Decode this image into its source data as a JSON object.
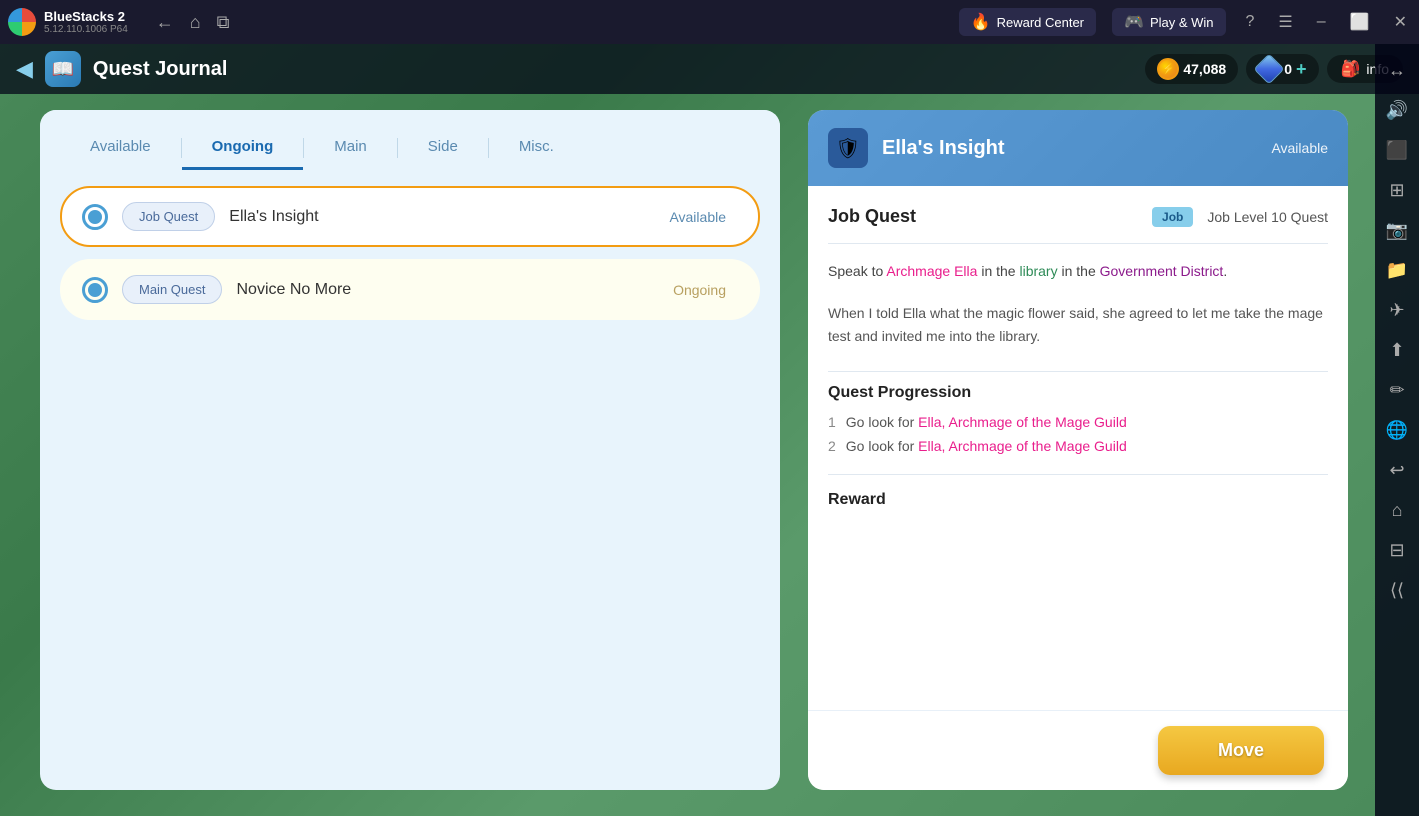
{
  "app": {
    "name": "BlueStacks 2",
    "version": "5.12.110.1006 P64",
    "logo_colors": [
      "#e74c3c",
      "#f39c12",
      "#2ecc71",
      "#3498db"
    ]
  },
  "topbar": {
    "back_label": "←",
    "home_label": "⌂",
    "copy_label": "⧉",
    "reward_center_label": "Reward Center",
    "play_win_label": "Play & Win",
    "help_label": "?",
    "menu_label": "☰",
    "minimize_label": "–",
    "restore_label": "⬜",
    "close_label": "✕",
    "back_arrow_label": "⟨⟨"
  },
  "game_ui": {
    "back_arrow": "◀",
    "quest_journal_title": "Quest Journal",
    "coin_amount": "47,088",
    "gem_amount": "0",
    "add_label": "+",
    "bag_icon": "🎒",
    "info_label": "info"
  },
  "quest_journal": {
    "tabs": [
      {
        "id": "available",
        "label": "Available",
        "active": false
      },
      {
        "id": "ongoing",
        "label": "Ongoing",
        "active": true
      },
      {
        "id": "main",
        "label": "Main",
        "active": false
      },
      {
        "id": "side",
        "label": "Side",
        "active": false
      },
      {
        "id": "misc",
        "label": "Misc.",
        "active": false
      }
    ],
    "quests": [
      {
        "id": "ellas-insight",
        "type": "Job Quest",
        "name": "Ella's Insight",
        "status": "Available",
        "selected": true
      },
      {
        "id": "novice-no-more",
        "type": "Main Quest",
        "name": "Novice No More",
        "status": "Ongoing",
        "selected": false
      }
    ]
  },
  "quest_detail": {
    "title": "Ella's Insight",
    "status": "Available",
    "type_label": "Job Quest",
    "job_badge": "Job",
    "level_label": "Job Level 10 Quest",
    "description_parts": [
      {
        "text": "Speak to ",
        "type": "normal"
      },
      {
        "text": "Archmage Ella",
        "type": "pink"
      },
      {
        "text": " in the ",
        "type": "normal"
      },
      {
        "text": "library",
        "type": "green"
      },
      {
        "text": " in the ",
        "type": "normal"
      },
      {
        "text": "Government District",
        "type": "purple"
      },
      {
        "text": ".",
        "type": "normal"
      }
    ],
    "story": "When I told Ella what the magic flower said, she agreed to let me take the mage test and invited me into the library.",
    "progression_title": "Quest Progression",
    "progression_items": [
      {
        "num": "1",
        "text_before": "Go look for ",
        "link": "Ella, Archmage of the Mage Guild",
        "text_after": ""
      },
      {
        "num": "2",
        "text_before": "Go look for ",
        "link": "Ella, Archmage of the Mage Guild",
        "text_after": ""
      }
    ],
    "reward_title": "Reward",
    "move_btn_label": "Move"
  },
  "right_sidebar": {
    "icons": [
      "↔",
      "🔊",
      "⬛",
      "⊞",
      "📷",
      "📁",
      "✈",
      "⬆",
      "✏",
      "🌐",
      "↩",
      "⌂",
      "⊟",
      "⟨⟨"
    ]
  }
}
